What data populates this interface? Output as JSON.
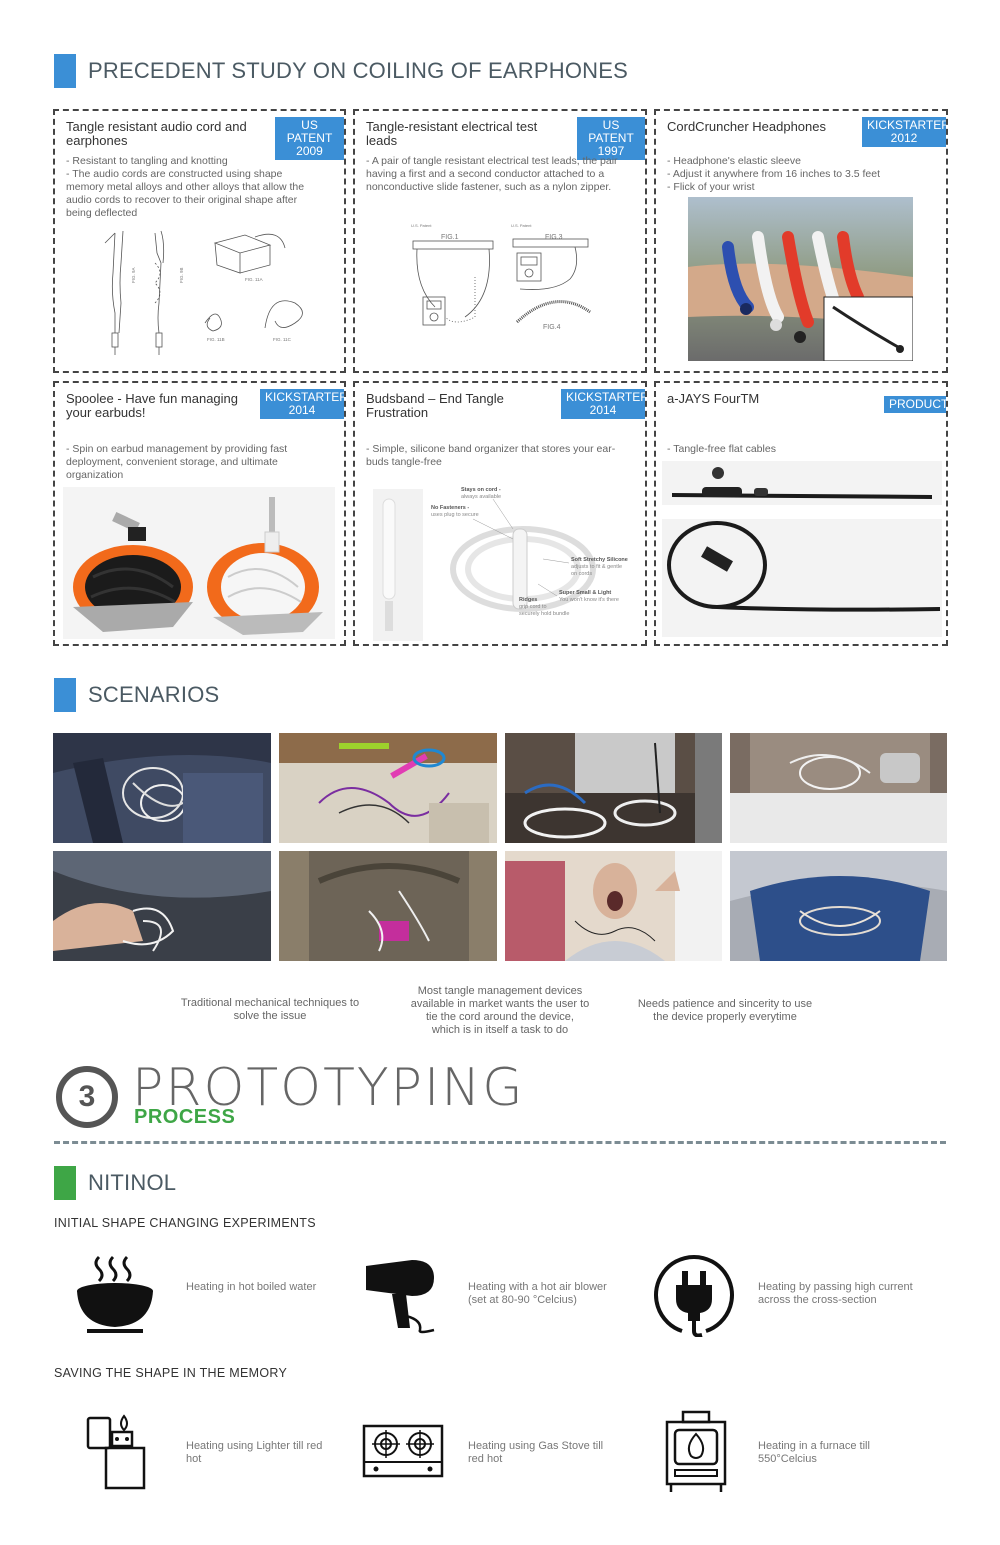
{
  "precedent": {
    "title": "PRECEDENT STUDY ON COILING OF EARPHONES",
    "cards": [
      {
        "title": "Tangle resistant audio cord and earphones",
        "badge": [
          "US PATENT",
          "2009"
        ],
        "desc": [
          "- Resistant to tangling and knotting",
          "- The audio cords are constructed using shape",
          "memory metal alloys and other alloys that allow the",
          "audio cords to recover to their original shape after",
          "being deflected"
        ],
        "fig_labels": [
          "FIG. 9A",
          "FIG. 9B",
          "FIG. 11A",
          "FIG. 11B",
          "FIG. 11C"
        ]
      },
      {
        "title": "Tangle-resistant electrical test leads",
        "badge": [
          "US PATENT",
          "1997"
        ],
        "desc": [
          "- A pair of tangle resistant electrical test leads, the pair",
          "having a first and a second conductor attached to a",
          "nonconductive slide fastener, such as a nylon zipper."
        ],
        "fig_labels": [
          "FIG.1",
          "FIG.3",
          "FIG.4",
          "U.S. Patent",
          "U.S. Patent"
        ]
      },
      {
        "title": "CordCruncher Headphones",
        "badge": [
          "KICKSTARTER",
          "2012"
        ],
        "desc": [
          "- Headphone's elastic sleeve",
          "- Adjust it anywhere from 16 inches to 3.5 feet",
          "- Flick of your wrist"
        ]
      },
      {
        "title": "Spoolee - Have fun managing your earbuds!",
        "badge": [
          "KICKSTARTER",
          "2014"
        ],
        "desc": [
          "- Spin on earbud management by providing fast",
          "deployment, convenient storage, and ultimate",
          "organization"
        ]
      },
      {
        "title": "Budsband – End Tangle Frustration",
        "badge": [
          "KICKSTARTER",
          "2014"
        ],
        "desc": [
          "- Simple, silicone band organizer that stores your ear-",
          "buds tangle-free"
        ],
        "callouts": [
          "Stays on cord -",
          "always available",
          "No Fasteners -",
          "uses plug to secure",
          "Soft Stretchy Silicone",
          "adjusts to fit & gentle",
          "on cords",
          "Super Small & Light",
          "You won't know it's there",
          "Ridges",
          "grip cord to",
          "securely hold bundle"
        ]
      },
      {
        "title": "a-JAYS FourTM",
        "badge": [
          "PRODUCT"
        ],
        "desc": [
          "- Tangle-free flat cables"
        ]
      }
    ]
  },
  "scenarios": {
    "title": "SCENARIOS",
    "captions": [
      [
        "Traditional mechanical techniques to",
        "solve the issue"
      ],
      [
        "Most tangle management devices",
        "available in market wants the user to",
        "tie the cord around the device,",
        "which is in itself a task to do"
      ],
      [
        "Needs patience and sincerity to use",
        "the device properly everytime"
      ]
    ]
  },
  "prototyping": {
    "number": "3",
    "title": "PROTOTYPING",
    "subtitle": "PROCESS"
  },
  "nitinol": {
    "title": "NITINOL",
    "initial_heading": "INITIAL SHAPE CHANGING EXPERIMENTS",
    "initial": [
      {
        "icon": "boiling-pot-icon",
        "text": [
          "Heating in hot boiled water"
        ]
      },
      {
        "icon": "hair-dryer-icon",
        "text": [
          "Heating with a hot air blower",
          "(set at 80-90 °Celcius)"
        ]
      },
      {
        "icon": "plug-icon",
        "text": [
          "Heating by passing high current",
          "across the cross-section"
        ]
      }
    ],
    "saving_heading": "SAVING THE SHAPE IN THE MEMORY",
    "saving": [
      {
        "icon": "lighter-icon",
        "text": [
          "Heating using Lighter till red",
          "hot"
        ]
      },
      {
        "icon": "gas-stove-icon",
        "text": [
          "Heating using Gas Stove till",
          "red hot"
        ]
      },
      {
        "icon": "furnace-icon",
        "text": [
          "Heating in a furnace till",
          "550°Celcius"
        ]
      }
    ]
  },
  "colors": {
    "accent_blue": "#3b8fd6",
    "accent_green": "#3ea646",
    "orange": "#f26a1b"
  }
}
